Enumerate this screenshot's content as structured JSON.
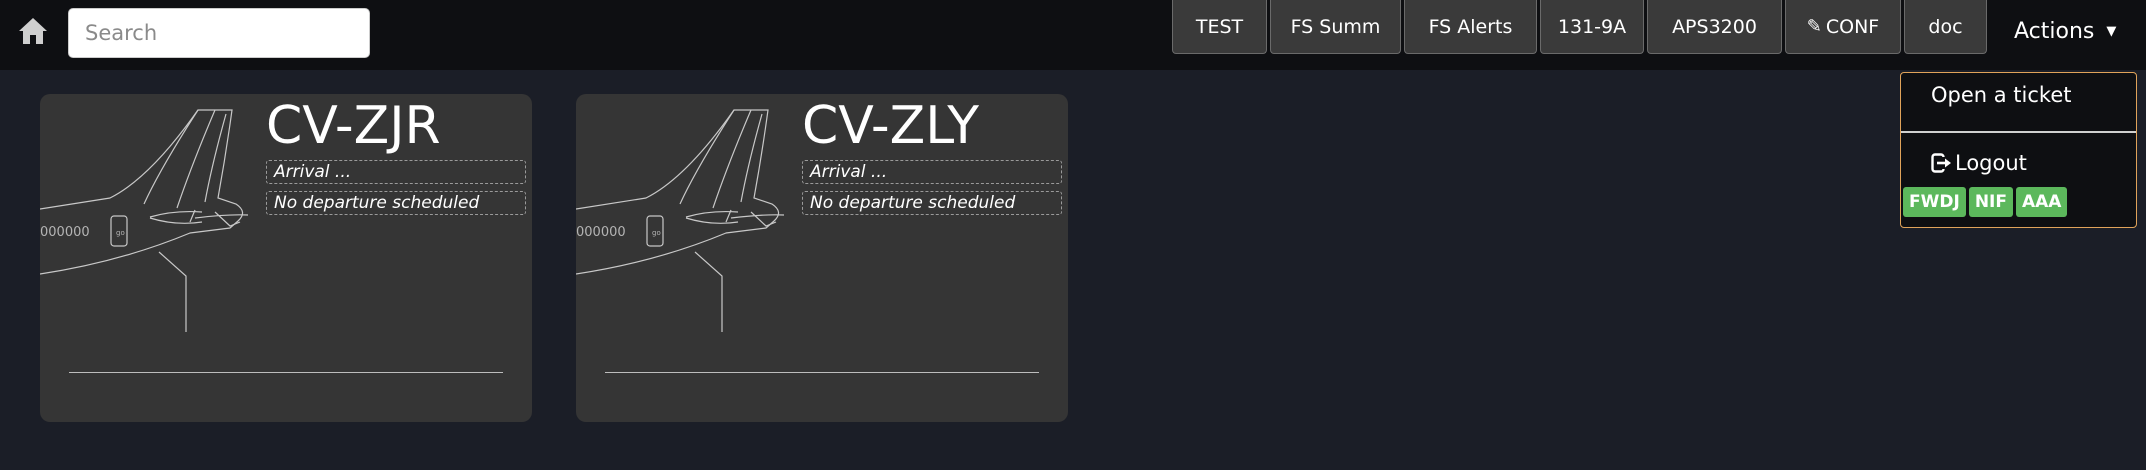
{
  "search": {
    "placeholder": "Search"
  },
  "nav": {
    "buttons": [
      {
        "label": "TEST",
        "icon": ""
      },
      {
        "label": "FS Summ",
        "icon": ""
      },
      {
        "label": "FS Alerts",
        "icon": ""
      },
      {
        "label": "131-9A",
        "icon": ""
      },
      {
        "label": "APS3200",
        "icon": ""
      },
      {
        "label": "CONF",
        "icon": "pencil-icon"
      },
      {
        "label": "doc",
        "icon": ""
      }
    ],
    "actions_label": "Actions"
  },
  "dropdown": {
    "open_ticket": "Open a ticket",
    "logout": "Logout",
    "tags": [
      "FWDJ",
      "NIF",
      "AAA"
    ],
    "accent_color": "#e0a35a",
    "tag_color": "#5cb85c"
  },
  "aircraft": [
    {
      "registration": "CV-ZJR",
      "arrival": "Arrival ...",
      "departure": "No departure scheduled",
      "fuselage_text": "000000"
    },
    {
      "registration": "CV-ZLY",
      "arrival": "Arrival ...",
      "departure": "No departure scheduled",
      "fuselage_text": "000000"
    }
  ]
}
